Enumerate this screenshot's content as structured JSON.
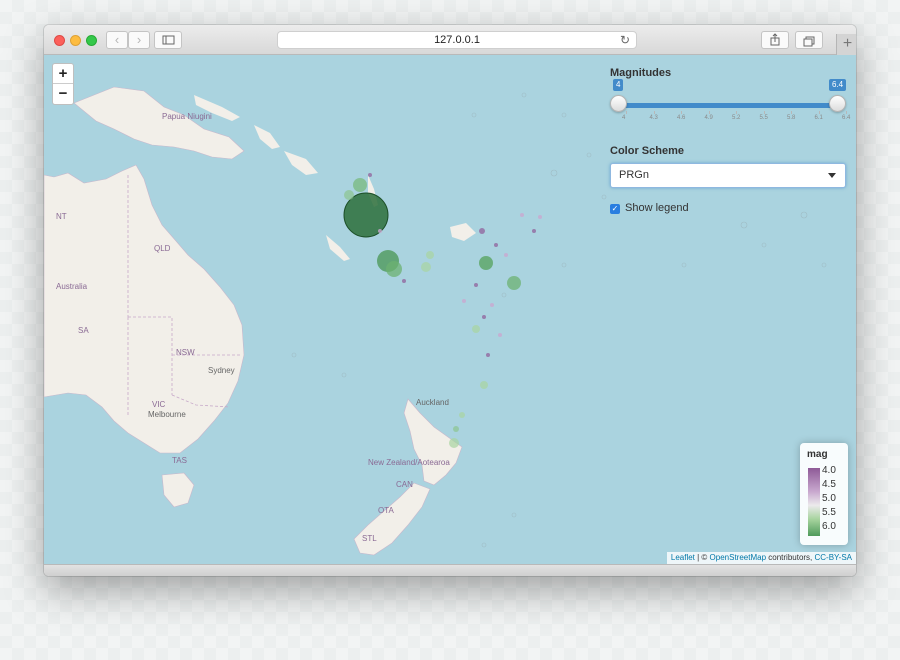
{
  "browser": {
    "url": "127.0.0.1",
    "back_icon": "chevron-left-icon",
    "forward_icon": "chevron-right-icon",
    "sidebar_icon": "sidebar-icon",
    "reload_icon": "reload-icon",
    "share_icon": "share-icon",
    "tabs_icon": "tabs-icon",
    "new_tab_label": "+"
  },
  "map": {
    "zoom_in_label": "+",
    "zoom_out_label": "−",
    "labels": {
      "papua": "Papua Niugini",
      "nt": "NT",
      "qld": "QLD",
      "australia": "Australia",
      "sa": "SA",
      "nsw": "NSW",
      "sydney": "Sydney",
      "vic": "VIC",
      "melbourne": "Melbourne",
      "tas": "TAS",
      "auckland": "Auckland",
      "nz": "New Zealand/Aotearoa",
      "can": "CAN",
      "ota": "OTA",
      "stl": "STL"
    },
    "water_color": "#aad3df",
    "land_color": "#f2efe9"
  },
  "controls": {
    "magnitudes_title": "Magnitudes",
    "slider_min_value": "4",
    "slider_max_value": "6.4",
    "slider_range": [
      4,
      6.4
    ],
    "ticks": [
      "4",
      "4.3",
      "4.6",
      "4.9",
      "5.2",
      "5.5",
      "5.8",
      "6.1",
      "6.4"
    ],
    "color_scheme_title": "Color Scheme",
    "color_scheme_value": "PRGn",
    "show_legend_label": "Show legend",
    "show_legend_checked": true
  },
  "legend": {
    "title": "mag",
    "labels": [
      "4.0",
      "4.5",
      "5.0",
      "5.5",
      "6.0"
    ]
  },
  "attribution": {
    "leaflet": "Leaflet",
    "sep": " | © ",
    "osm": "OpenStreetMap",
    "contributors": " contributors, ",
    "license": "CC-BY-SA"
  }
}
